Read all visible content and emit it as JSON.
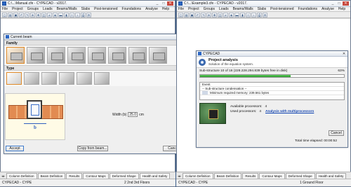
{
  "left_window": {
    "title": "C:\\...\\Manual.cfe - CYPECAD - v2017.",
    "menu": [
      "File",
      "Project",
      "Groups",
      "Loads",
      "Beams/Walls",
      "Slabs",
      "Post-tensioned",
      "Foundations",
      "Analyse",
      "Help"
    ],
    "status_left": "CYPECAD - CYPE",
    "status_right": "2  2nd 3rd Floors",
    "tabs": [
      "Column Definition",
      "Beam Definition",
      "Results",
      "Contour Maps",
      "Deformed Shape",
      "Health and Safety"
    ]
  },
  "right_window": {
    "title": "C:\\...\\Example3.cfe - CYPECAD - v2017.",
    "menu": [
      "File",
      "Project",
      "Groups",
      "Loads",
      "Beams/Walls",
      "Slabs",
      "Post-tensioned",
      "Foundations",
      "Analyse",
      "Help"
    ],
    "status_left": "CYPECAD - CYPE",
    "status_right": "1  Ground Floor",
    "tabs": [
      "Column Definition",
      "Beam Definition",
      "Results",
      "Contour Maps",
      "Deformed Shape",
      "Health and Safety"
    ]
  },
  "current_beam_dialog": {
    "title": "Current beam",
    "family_label": "Family",
    "type_label": "Type",
    "dimension_label": "b",
    "width_label": "Width (b)",
    "width_value": "25.0",
    "width_unit": "cm",
    "accept_label": "Accept",
    "copy_label": "Copy from beam...",
    "cancel_label": "Cancel"
  },
  "analysis_dialog": {
    "window_title": "CYPECAD",
    "heading": "Project analysis",
    "subheading": "Solution of the equation system.",
    "progress_text": "Sub-structure 10 of 16 (228.228.294.839 bytes free in disk)",
    "progress_percent_label": "63%",
    "progress_percent": 63,
    "log_header": "Event",
    "log_line": "-- Sub-structure condensation --",
    "memory_line": "Minimum required memory: 239.561 bytes",
    "available_label": "Available processors:",
    "available_value": "4",
    "used_label": "Used processors:",
    "used_value": "4",
    "multiprocessors_link": "Analysis with multiprocessors",
    "cancel_label": "Cancel",
    "elapsed_label": "Total time elapsed:",
    "elapsed_value": "00:00:52"
  },
  "colors": {
    "accent": "#3b78c9",
    "progress_green": "#2b9a2b",
    "beam_brick": "#e28b52"
  }
}
